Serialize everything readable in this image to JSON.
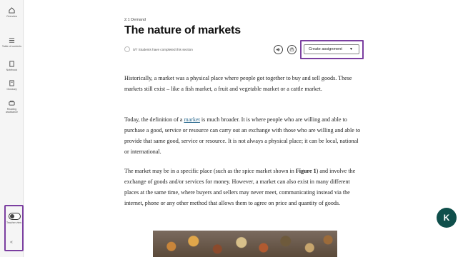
{
  "sidebar": {
    "items": [
      {
        "label": "Overview",
        "icon": "home-icon"
      },
      {
        "label": "Table of contents",
        "icon": "list-icon"
      },
      {
        "label": "Notebook",
        "icon": "notebook-icon"
      },
      {
        "label": "Glossary",
        "icon": "book-icon"
      },
      {
        "label": "Reading assistance",
        "icon": "reading-icon"
      }
    ],
    "teacher_view_label": "Teacher view",
    "collapse_label": "«"
  },
  "breadcrumb": "2.1 Demand",
  "title": "The nature of markets",
  "completed_text": "0/7 Students have completed this section",
  "assign_button_label": "Create assignment",
  "assign_button_arrow": "▼",
  "paragraphs": {
    "p1": "Historically, a market was a physical place where people got together to buy and sell goods. These markets still exist – like a fish market, a fruit and vegetable market or a cattle market.",
    "p2_before": "Today, the definition of a ",
    "p2_link": "market",
    "p2_after": " is much broader. It is where people who are willing and able to purchase a good, service or resource can carry out an exchange with those who are willing and able to provide that same good, service or resource. It is not always a physical place; it can be local, national or international.",
    "p3_before": "The market may be in a specific place (such as the spice market shown in ",
    "p3_bold": "Figure 1",
    "p3_after": ") and involve the exchange of goods and/or services for money. However, a market can also exist in many different places at the same time, where buyers and sellers may never meet, communicating instead via the internet, phone or any other method that allows them to agree on price and quantity of goods."
  },
  "chat_widget_glyph": "K",
  "colors": {
    "highlight": "#7b3fa0",
    "link": "#2a6a8f",
    "chat": "#0f4f4b"
  }
}
